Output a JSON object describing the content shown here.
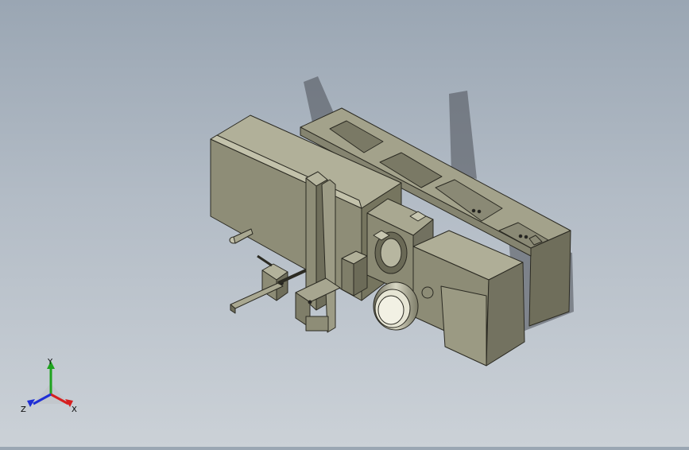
{
  "viewport": {
    "background_top": "#9aa6b3",
    "background_bottom": "#cbd1d7",
    "model_color": "#8f8e77",
    "model_color_light": "#b4b39c",
    "model_color_dark": "#6b6a57",
    "edge_color": "#2b2a22"
  },
  "triad": {
    "x_label": "X",
    "y_label": "Y",
    "z_label": "Z",
    "x_color": "#d61f1f",
    "y_color": "#1fa31f",
    "z_color": "#1f2fd6"
  }
}
